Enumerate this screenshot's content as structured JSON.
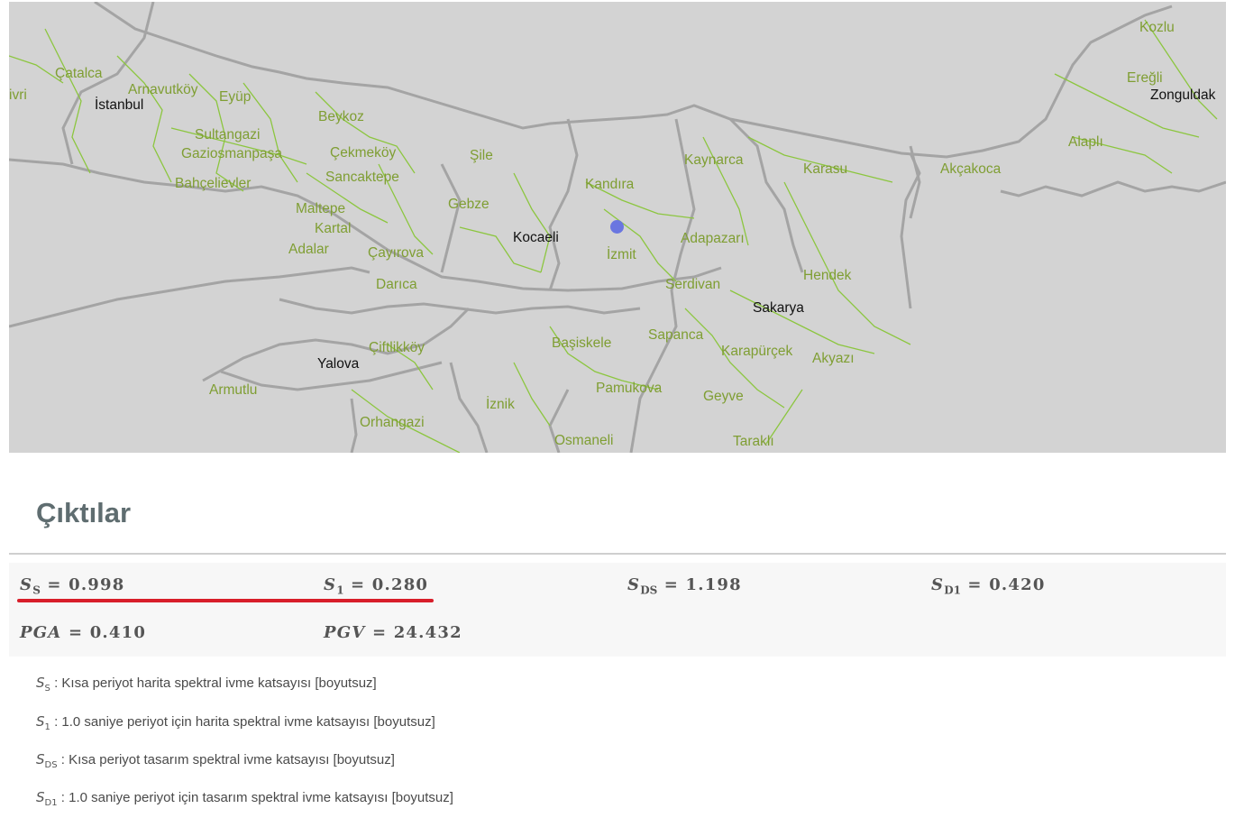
{
  "map": {
    "places": [
      {
        "name": "Kozlu",
        "major": false
      },
      {
        "name": "Ereğli",
        "major": false
      },
      {
        "name": "Zonguldak",
        "major": true
      },
      {
        "name": "Alaplı",
        "major": false
      },
      {
        "name": "Akçakoca",
        "major": false
      },
      {
        "name": "ivri",
        "major": false
      },
      {
        "name": "Çatalca",
        "major": false
      },
      {
        "name": "Arnavutköy",
        "major": false
      },
      {
        "name": "Eyüp",
        "major": false
      },
      {
        "name": "İstanbul",
        "major": true
      },
      {
        "name": "Beykoz",
        "major": false
      },
      {
        "name": "Sultangazi",
        "major": false
      },
      {
        "name": "Gaziosmanpaşa",
        "major": false
      },
      {
        "name": "Çekmeköy",
        "major": false
      },
      {
        "name": "Şile",
        "major": false
      },
      {
        "name": "Bahçelievler",
        "major": false
      },
      {
        "name": "Sancaktepe",
        "major": false
      },
      {
        "name": "Kaynarca",
        "major": false
      },
      {
        "name": "Karasu",
        "major": false
      },
      {
        "name": "Kandıra",
        "major": false
      },
      {
        "name": "Maltepe",
        "major": false
      },
      {
        "name": "Gebze",
        "major": false
      },
      {
        "name": "Kartal",
        "major": false
      },
      {
        "name": "Kocaeli",
        "major": true
      },
      {
        "name": "Adapazarı",
        "major": false
      },
      {
        "name": "Adalar",
        "major": false
      },
      {
        "name": "Çayırova",
        "major": false
      },
      {
        "name": "İzmit",
        "major": false
      },
      {
        "name": "Hendek",
        "major": false
      },
      {
        "name": "Darıca",
        "major": false
      },
      {
        "name": "Serdivan",
        "major": false
      },
      {
        "name": "Sakarya",
        "major": true
      },
      {
        "name": "Sapanca",
        "major": false
      },
      {
        "name": "Başiskele",
        "major": false
      },
      {
        "name": "Çiftlikköy",
        "major": false
      },
      {
        "name": "Karapürçek",
        "major": false
      },
      {
        "name": "Yalova",
        "major": true
      },
      {
        "name": "Akyazı",
        "major": false
      },
      {
        "name": "Armutlu",
        "major": false
      },
      {
        "name": "Pamukova",
        "major": false
      },
      {
        "name": "Geyve",
        "major": false
      },
      {
        "name": "İznik",
        "major": false
      },
      {
        "name": "Orhangazi",
        "major": false
      },
      {
        "name": "Osmaneli",
        "major": false
      },
      {
        "name": "Taraklı",
        "major": false
      }
    ],
    "marker_icon": "location-dot-icon",
    "colors": {
      "background": "#d3d3d3",
      "district_border": "#8cc63f",
      "province_border": "#a4a4a4",
      "marker": "#6a76e0"
    }
  },
  "outputs": {
    "title": "Çıktılar",
    "results": [
      {
        "symbol": "S",
        "sub": "S",
        "value": "0.998"
      },
      {
        "symbol": "S",
        "sub": "1",
        "value": "0.280"
      },
      {
        "symbol": "S",
        "sub": "DS",
        "value": "1.198"
      },
      {
        "symbol": "S",
        "sub": "D1",
        "value": "0.420"
      },
      {
        "symbol": "PGA",
        "sub": "",
        "value": "0.410"
      },
      {
        "symbol": "PGV",
        "sub": "",
        "value": "24.432"
      }
    ],
    "highlight_color": "#d81e2a",
    "descriptions": [
      {
        "symbol": "S",
        "sub": "S",
        "text": ": Kısa periyot harita spektral ivme katsayısı [boyutsuz]"
      },
      {
        "symbol": "S",
        "sub": "1",
        "text": ": 1.0 saniye periyot için harita spektral ivme katsayısı [boyutsuz]"
      },
      {
        "symbol": "S",
        "sub": "DS",
        "text": ": Kısa periyot tasarım spektral ivme katsayısı [boyutsuz]"
      },
      {
        "symbol": "S",
        "sub": "D1",
        "text": ": 1.0 saniye periyot için tasarım spektral ivme katsayısı [boyutsuz]"
      }
    ]
  }
}
